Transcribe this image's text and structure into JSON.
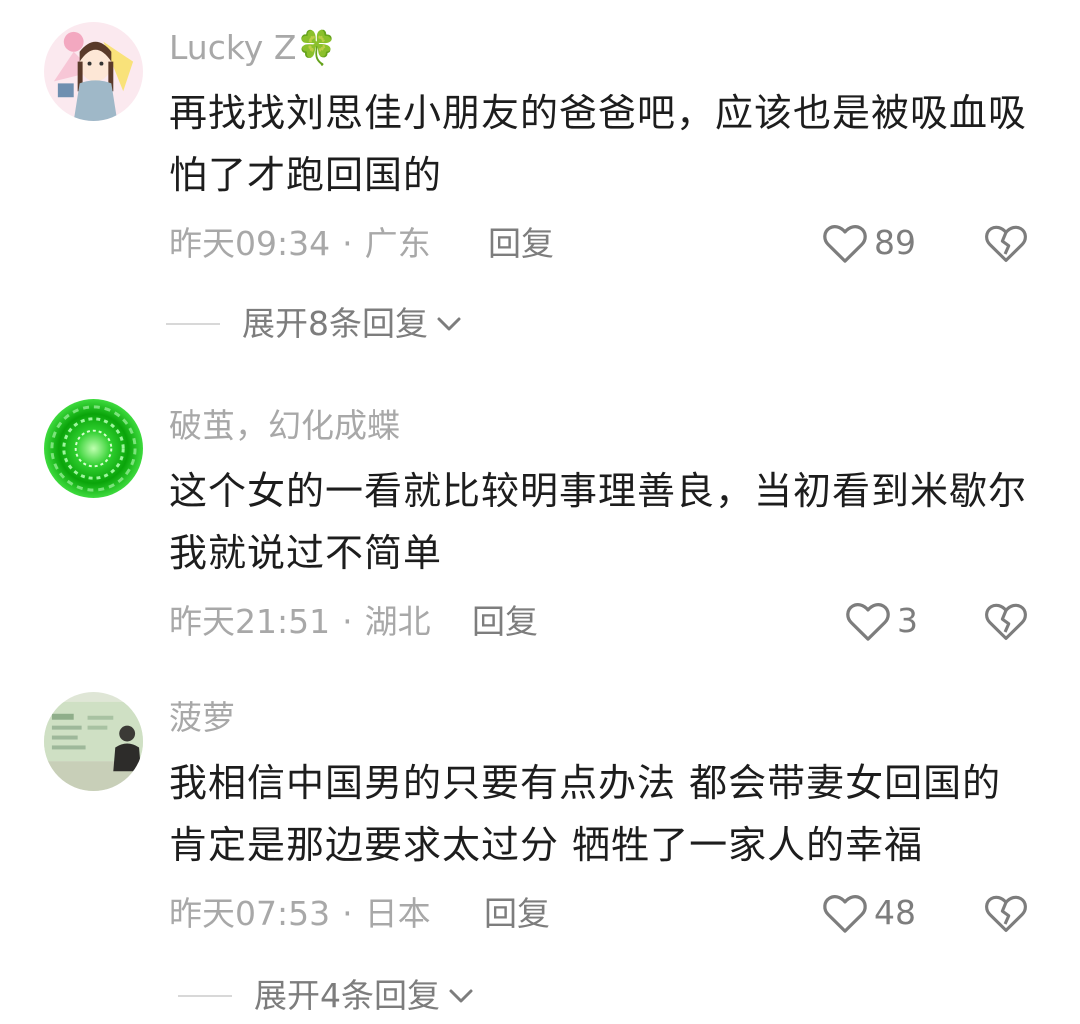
{
  "comments": [
    {
      "username": "Lucky Z🍀",
      "text": "再找找刘思佳小朋友的爸爸吧，应该也是被吸血吸怕了才跑回国的",
      "time": "昨天09:34",
      "location": "广东",
      "reply_label": "回复",
      "likes": "89",
      "expand_label": "展开8条回复"
    },
    {
      "username": "破茧，幻化成蝶",
      "text": "这个女的一看就比较明事理善良，当初看到米歇尔我就说过不简单",
      "time": "昨天21:51",
      "location": "湖北",
      "reply_label": "回复",
      "likes": "3"
    },
    {
      "username": "菠萝",
      "text": "我相信中国男的只要有点办法 都会带妻女回国的 肯定是那边要求太过分 牺牲了一家人的幸福",
      "time": "昨天07:53",
      "location": "日本",
      "reply_label": "回复",
      "likes": "48",
      "expand_label": "展开4条回复"
    }
  ],
  "meta_separator": "·",
  "colors": {
    "username": "#a8a8a8",
    "text": "#1d1d1d",
    "action": "#7d7d7d"
  },
  "icons": {
    "like": "heart-outline-icon",
    "dislike": "broken-heart-icon",
    "expand": "chevron-down-icon"
  }
}
